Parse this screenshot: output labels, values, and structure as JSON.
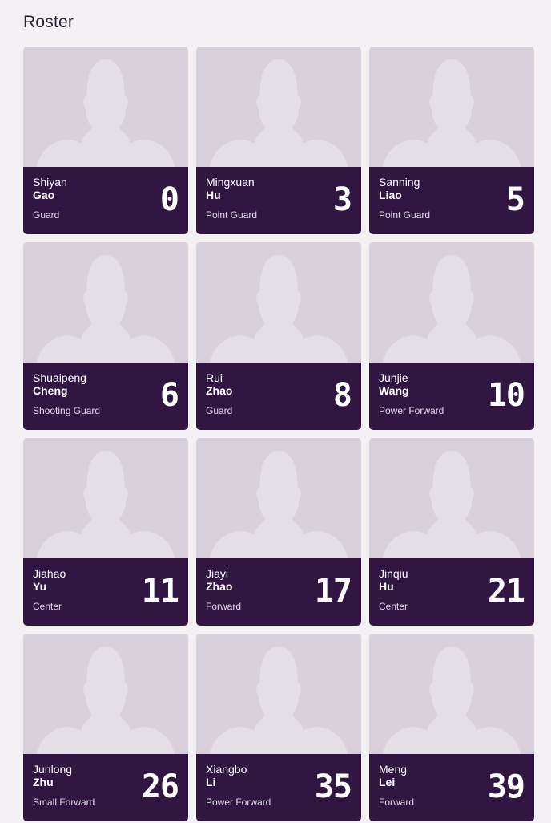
{
  "page": {
    "title": "Roster"
  },
  "players": [
    {
      "first": "Shiyan",
      "last": "Gao",
      "position": "Guard",
      "number": "0"
    },
    {
      "first": "Mingxuan",
      "last": "Hu",
      "position": "Point Guard",
      "number": "3"
    },
    {
      "first": "Sanning",
      "last": "Liao",
      "position": "Point Guard",
      "number": "5"
    },
    {
      "first": "Shuaipeng",
      "last": "Cheng",
      "position": "Shooting Guard",
      "number": "6"
    },
    {
      "first": "Rui",
      "last": "Zhao",
      "position": "Guard",
      "number": "8"
    },
    {
      "first": "Junjie",
      "last": "Wang",
      "position": "Power Forward",
      "number": "10"
    },
    {
      "first": "Jiahao",
      "last": "Yu",
      "position": "Center",
      "number": "11"
    },
    {
      "first": "Jiayi",
      "last": "Zhao",
      "position": "Forward",
      "number": "17"
    },
    {
      "first": "Jinqiu",
      "last": "Hu",
      "position": "Center",
      "number": "21"
    },
    {
      "first": "Junlong",
      "last": "Zhu",
      "position": "Small Forward",
      "number": "26"
    },
    {
      "first": "Xiangbo",
      "last": "Li",
      "position": "Power Forward",
      "number": "35"
    },
    {
      "first": "Meng",
      "last": "Lei",
      "position": "Forward",
      "number": "39"
    }
  ],
  "colors": {
    "page_bg": "#f3f1f4",
    "card_band": "#321642",
    "photo_bg": "#d8d1dc",
    "silhouette": "#e4dfe7"
  },
  "icons": {
    "player_photo": "silhouette-placeholder-icon"
  }
}
